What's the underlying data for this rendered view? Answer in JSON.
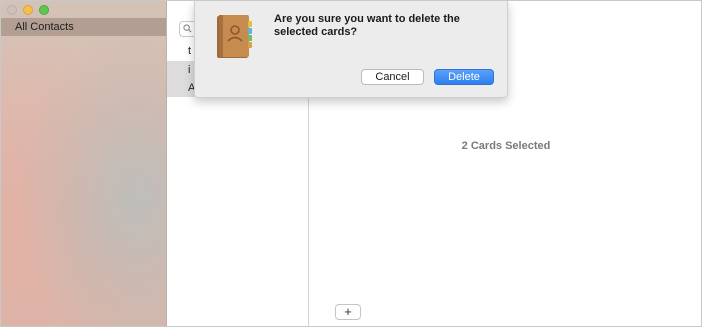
{
  "sidebar": {
    "items": [
      {
        "label": "All Contacts"
      }
    ]
  },
  "list": {
    "rows": [
      {
        "label": "t",
        "selected": false
      },
      {
        "label": "i",
        "selected": true
      },
      {
        "label": "A",
        "selected": true
      }
    ]
  },
  "detail": {
    "selected_count_text": "2 Cards Selected",
    "add_label": "+"
  },
  "dialog": {
    "message": "Are you sure you want to delete the selected cards?",
    "cancel_label": "Cancel",
    "delete_label": "Delete",
    "icon": "contacts-book-icon"
  },
  "colors": {
    "accent": "#2f7ff0",
    "minimize": "#f5bf4f",
    "maximize": "#61c554"
  }
}
